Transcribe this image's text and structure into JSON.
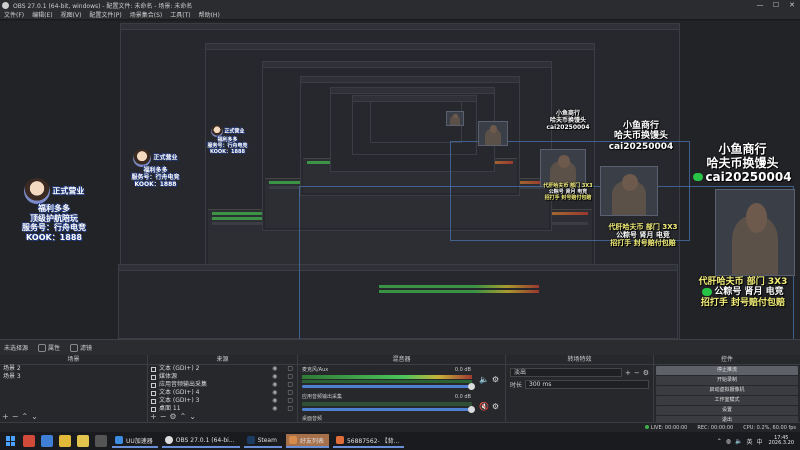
{
  "window": {
    "title": "OBS 27.0.1 (64-bit, windows) - 配置文件: 未命名 - 场景: 未命名",
    "controls": [
      "—",
      "☐",
      "✕"
    ]
  },
  "menu": [
    "文件(F)",
    "编辑(E)",
    "视图(V)",
    "配置文件(P)",
    "场景集合(S)",
    "工具(T)",
    "帮助(H)"
  ],
  "preview": {
    "promo": {
      "line1": "小鱼商行",
      "line2": "哈夫币换馒头",
      "line3": "cai20250004",
      "line4": "代肝哈夫币 部门 3X3",
      "line5": "公粽号  肾月 电竞",
      "line6": "招打手 封号赔付包赔"
    },
    "badge": {
      "line1": "正式营业",
      "line2": "福利多多",
      "line3": "顶级护航陪玩",
      "line4": "服务号：行舟电竞",
      "line5": "KOOK：1888"
    }
  },
  "scene_info": {
    "label": "未选择源",
    "properties": "属性",
    "filters": "滤镜"
  },
  "scenes": {
    "header": "场景",
    "items": [
      "场景 2",
      "场景 3"
    ]
  },
  "sources": {
    "header": "来源",
    "items": [
      "文本 (GDI+) 2",
      "媒体源",
      "应用音频输出采集",
      "文本 (GDI+) 4",
      "文本 (GDI+) 3",
      "桌面 11"
    ]
  },
  "mixer": {
    "header": "混音器",
    "tracks": [
      {
        "name": "麦克风/Aux",
        "db": "0.0 dB"
      },
      {
        "name": "应用音频输出采集",
        "db": "0.0 dB"
      },
      {
        "name": "桌面音频",
        "db": ""
      }
    ]
  },
  "transitions": {
    "header": "转场特效",
    "selected": "淡出",
    "duration_label": "时长",
    "duration_value": "300 ms"
  },
  "controls": {
    "header": "控件",
    "buttons": [
      "停止推流",
      "开始录制",
      "启动虚拟摄像机",
      "工作室模式",
      "设置",
      "退出"
    ]
  },
  "status": {
    "live": "LIVE: 00:00:00",
    "rec": "REC: 00:00:00",
    "cpu": "CPU: 0.2%, 60.00 fps"
  },
  "taskbar": {
    "apps": [
      "UU加速器",
      "OBS 27.0.1 (64-bi...",
      "Steam",
      "好友列表",
      "56887562- 【背..."
    ],
    "tray": [
      "英",
      "中"
    ],
    "time": "17:45",
    "date": "2026.3.20"
  },
  "colors": {
    "accent": "#4f7fd0",
    "wechat": "#28c445",
    "highlight_app": "#a6704a"
  }
}
